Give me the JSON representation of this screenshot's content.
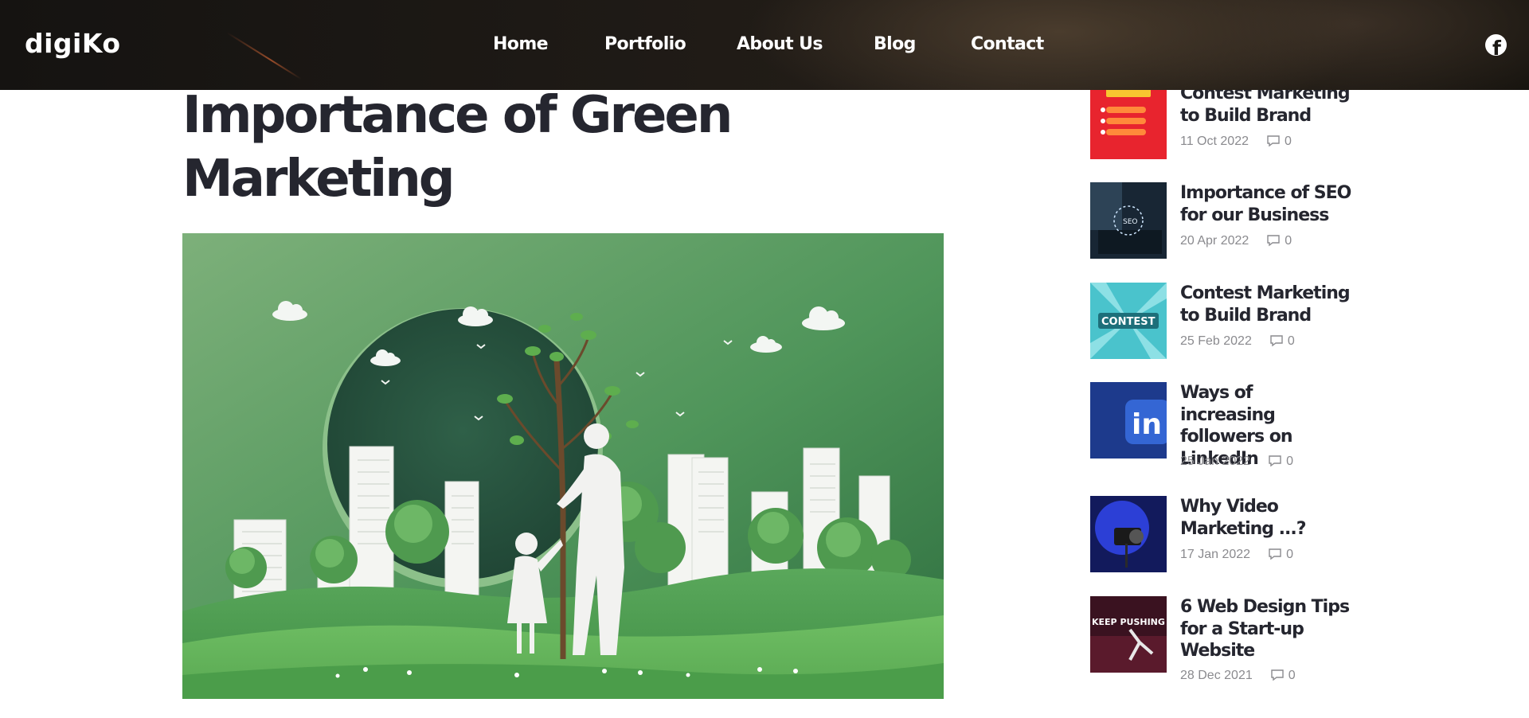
{
  "header": {
    "logo": "digiKo",
    "nav": [
      {
        "label": "Home"
      },
      {
        "label": "Portfolio"
      },
      {
        "label": "About Us"
      },
      {
        "label": "Blog"
      },
      {
        "label": "Contact"
      }
    ],
    "social_icon": "facebook-icon"
  },
  "main": {
    "title": "Importance of Green Marketing",
    "hero_image": "green-city-tree-illustration"
  },
  "sidebar": {
    "posts": [
      {
        "title": "Contest Marketing to Build Brand",
        "date": "11 Oct 2022",
        "comments": "0",
        "thumb": "contest-red"
      },
      {
        "title": "Importance of SEO for our Business",
        "date": "20 Apr 2022",
        "comments": "0",
        "thumb": "seo-laptop"
      },
      {
        "title": "Contest Marketing to Build Brand",
        "date": "25 Feb 2022",
        "comments": "0",
        "thumb": "contest-teal"
      },
      {
        "title": "Ways of increasing followers on LinkedIn",
        "date": "25 Jan 2022",
        "comments": "0",
        "thumb": "linkedin-blue"
      },
      {
        "title": "Why Video Marketing ...?",
        "date": "17 Jan 2022",
        "comments": "0",
        "thumb": "video-camera"
      },
      {
        "title": "6 Web Design Tips for a Start-up Website",
        "date": "28 Dec 2021",
        "comments": "0",
        "thumb": "keep-pushing"
      }
    ]
  },
  "colors": {
    "header_bg": "#1c1815",
    "title": "#25262f",
    "meta": "#8a8a8e",
    "hero_green": "#4e9a5a"
  }
}
